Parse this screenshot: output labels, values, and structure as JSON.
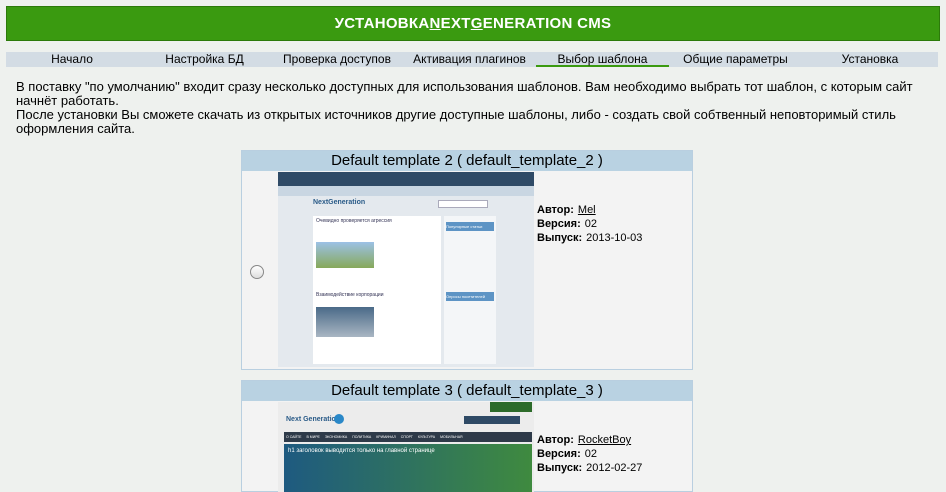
{
  "header": {
    "title_parts": [
      "УСТАНОВКА ",
      "N",
      "EXT ",
      "G",
      "ENERATION CMS"
    ]
  },
  "tabs": [
    {
      "label": "Начало"
    },
    {
      "label": "Настройка БД"
    },
    {
      "label": "Проверка доступов"
    },
    {
      "label": "Активация плагинов"
    },
    {
      "label": "Выбор шаблона",
      "active": true
    },
    {
      "label": "Общие параметры"
    },
    {
      "label": "Установка"
    }
  ],
  "intro": {
    "line1": "В поставку \"по умолчанию\" входит сразу несколько доступных для использования шаблонов. Вам необходимо выбрать тот шаблон, с которым сайт начнёт работать.",
    "line2": "После установки Вы сможете скачать из открытых источников другие доступные шаблоны, либо - создать свой собтвенный неповторимый стиль оформления сайта."
  },
  "templates": [
    {
      "title": "Default template 2 ( default_template_2 )",
      "author_label": "Автор:",
      "author": "Mel",
      "version_label": "Версия:",
      "version": "02",
      "release_label": "Выпуск:",
      "release": "2013-10-03",
      "preview": {
        "logo": "NextGeneration",
        "post1": "Очевидно проверяется агрессия",
        "post2": "Взаимодействие корпорации",
        "widget1": "Популярные статьи",
        "widget2": "Опросы посетителей"
      }
    },
    {
      "title": "Default template 3 ( default_template_3 )",
      "author_label": "Автор:",
      "author": "RocketBoy",
      "version_label": "Версия:",
      "version": "02",
      "release_label": "Выпуск:",
      "release": "2012-02-27",
      "preview": {
        "logo": "Next Generation",
        "nav": [
          "О САЙТЕ",
          "В МИРЕ",
          "ЭКОНОМИКА",
          "ПОЛИТИКА",
          "КРИМИНАЛ",
          "СПОРТ",
          "КУЛЬТУРА",
          "МОБИЛЬНАЯ"
        ],
        "headline": "h1 заголовок выводится только на главной странице"
      }
    }
  ],
  "colors": {
    "header_bg": "#3a9a10",
    "tab_bar": "#d3dce4",
    "title_bar": "#b9d2e2"
  }
}
